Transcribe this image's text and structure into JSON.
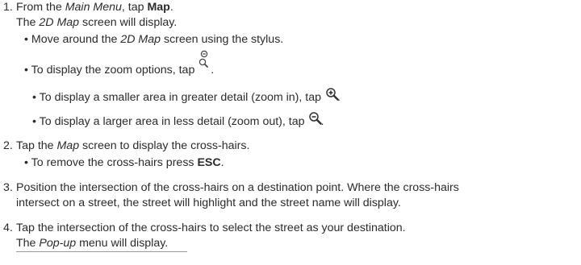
{
  "steps": [
    {
      "number": "1.",
      "lead": "From the ",
      "lead_italic": "Main Menu",
      "lead_mid": ", tap ",
      "lead_bold": "Map",
      "lead_end": ".",
      "sub_italic_pre": "The ",
      "sub_italic": "2D Map",
      "sub_end": " screen will display.",
      "bullets": {
        "move_pre": "Move around the ",
        "move_italic": "2D Map",
        "move_end": " screen using the stylus.",
        "zoom_opts": "To display the zoom options, tap ",
        "zoom_opts_end": ".",
        "zoom_in": "To display a smaller area in greater detail (zoom in), tap ",
        "zoom_in_end": ".",
        "zoom_out": "To display a larger area in less detail (zoom out), tap ",
        "zoom_out_end": "."
      }
    },
    {
      "number": "2.",
      "pre": "Tap the ",
      "italic": "Map",
      "end": " screen to display the cross-hairs.",
      "bullet_pre": "To remove the cross-hairs press ",
      "bullet_bold": "ESC",
      "bullet_end": "."
    },
    {
      "number": "3.",
      "line1": "Position the intersection of the cross-hairs on a destination point. Where the cross-hairs",
      "line2": "intersect on a street, the street will highlight and the street name will display."
    },
    {
      "number": "4.",
      "line1": "Tap the intersection of the cross-hairs to select the street as your destination.",
      "line2_pre": "The ",
      "line2_italic": "Pop-up",
      "line2_end": " menu will display."
    }
  ],
  "bullet_char": "•",
  "icons": {
    "zoom_options": "magnifier-icon",
    "zoom_in": "zoom-in-icon",
    "zoom_out": "zoom-out-icon"
  }
}
